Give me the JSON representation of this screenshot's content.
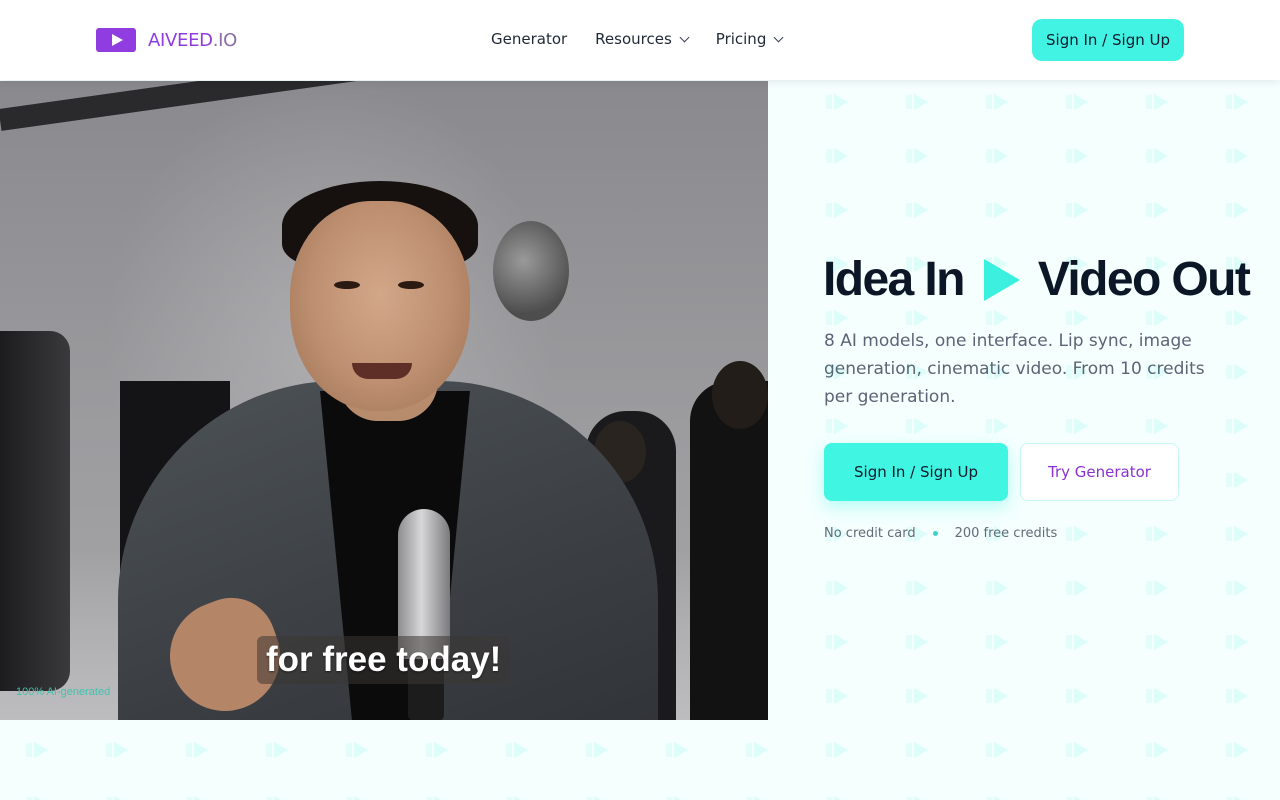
{
  "brand": {
    "name_part1": "AIVEED",
    "name_part2": ".IO",
    "accent_color": "#8f3ce0",
    "cyan_color": "#42f3e3"
  },
  "nav": {
    "items": [
      {
        "label": "Generator",
        "has_dropdown": false
      },
      {
        "label": "Resources",
        "has_dropdown": true
      },
      {
        "label": "Pricing",
        "has_dropdown": true
      }
    ],
    "auth_button": "Sign In / Sign Up"
  },
  "video": {
    "caption": "for free today!",
    "ai_tag": "100% AI-generated"
  },
  "hero": {
    "title_left": "Idea In",
    "title_right": "Video Out",
    "title_icon": "play-icon",
    "description": "8 AI models, one interface. Lip sync, image generation, cinematic video. From 10 credits per generation.",
    "primary_button": "Sign In / Sign Up",
    "secondary_button": "Try Generator",
    "meta": [
      "No credit card",
      "200 free credits"
    ]
  }
}
